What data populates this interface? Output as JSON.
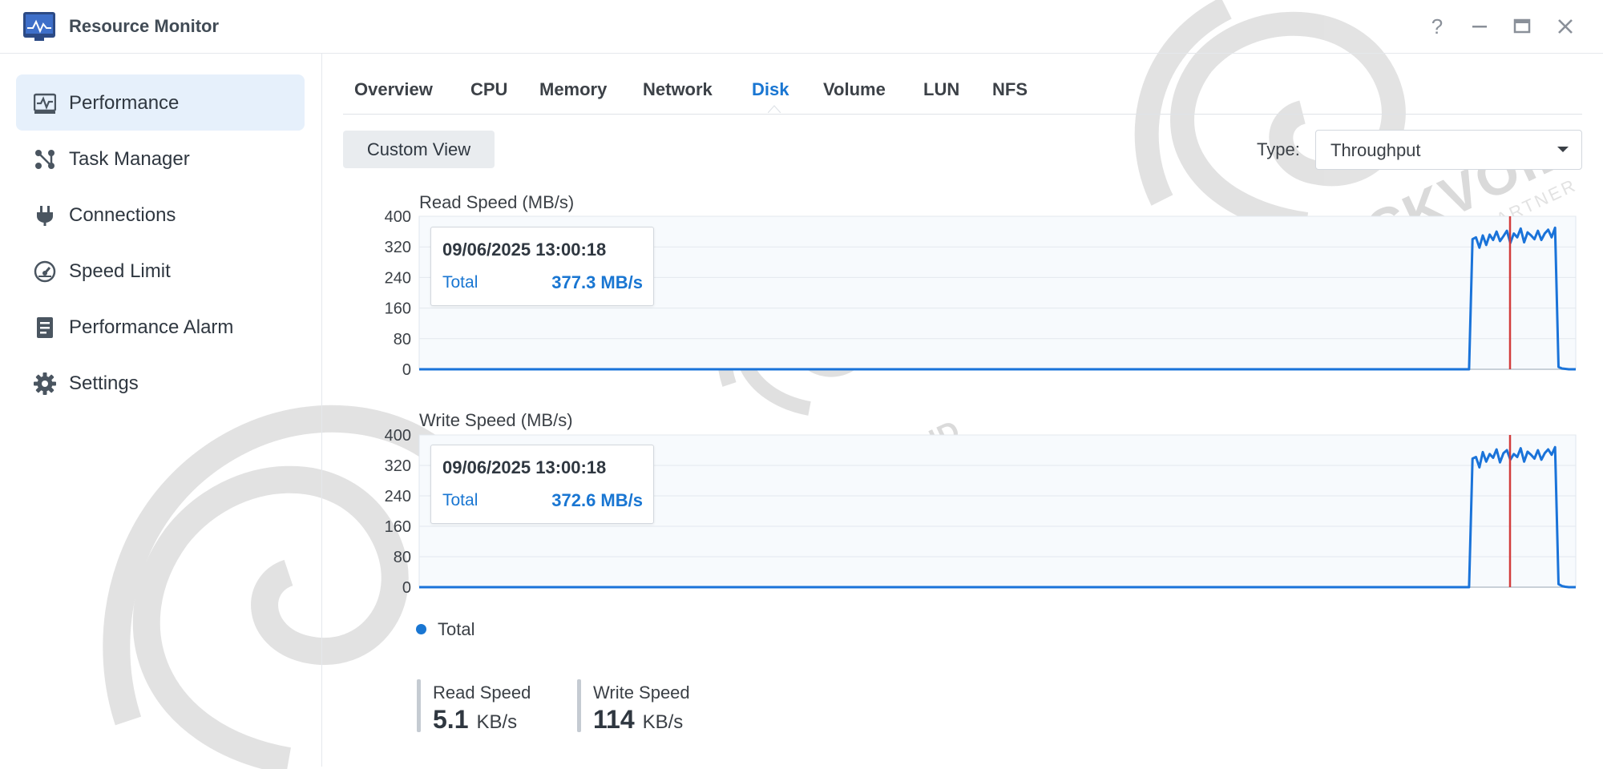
{
  "window": {
    "title": "Resource Monitor",
    "help_icon": "question-icon",
    "minimize_icon": "minimize-icon",
    "maximize_icon": "maximize-icon",
    "close_icon": "close-icon"
  },
  "sidebar": {
    "items": [
      {
        "label": "Performance",
        "icon": "performance-icon",
        "active": true
      },
      {
        "label": "Task Manager",
        "icon": "task-manager-icon",
        "active": false
      },
      {
        "label": "Connections",
        "icon": "plug-icon",
        "active": false
      },
      {
        "label": "Speed Limit",
        "icon": "gauge-icon",
        "active": false
      },
      {
        "label": "Performance Alarm",
        "icon": "document-icon",
        "active": false
      },
      {
        "label": "Settings",
        "icon": "gear-icon",
        "active": false
      }
    ]
  },
  "tabs": [
    {
      "label": "Overview",
      "active": false
    },
    {
      "label": "CPU",
      "active": false
    },
    {
      "label": "Memory",
      "active": false
    },
    {
      "label": "Network",
      "active": false
    },
    {
      "label": "Disk",
      "active": true
    },
    {
      "label": "Volume",
      "active": false
    },
    {
      "label": "LUN",
      "active": false
    },
    {
      "label": "NFS",
      "active": false
    }
  ],
  "toolbar": {
    "custom_view_label": "Custom View",
    "type_label": "Type:",
    "type_value": "Throughput"
  },
  "colors": {
    "accent": "#1976d2",
    "series_line": "#1a73d9",
    "cursor_line": "#d23c3c",
    "active_sidebar_bg": "#e6f0fb"
  },
  "chart_data": [
    {
      "type": "line",
      "title": "Read Speed (MB/s)",
      "ylim": [
        0,
        400
      ],
      "yticks": [
        "400",
        "320",
        "240",
        "160",
        "80",
        "0"
      ],
      "grid": true,
      "series": [
        {
          "name": "Total",
          "color": "#1a73d9",
          "values": [
            0,
            0,
            0,
            0,
            0,
            0,
            0,
            0,
            0,
            0,
            0,
            0,
            0,
            0,
            0,
            0,
            0,
            0,
            0,
            0,
            0,
            0,
            0,
            0,
            0,
            0,
            0,
            0,
            0,
            0,
            0,
            0,
            0,
            0,
            0,
            0,
            0,
            0,
            0,
            0,
            0,
            0,
            0,
            0,
            0,
            0,
            0,
            0,
            0,
            0,
            0,
            0,
            0,
            0,
            0,
            0,
            0,
            0,
            0,
            0,
            0,
            0,
            0,
            0,
            0,
            0,
            0,
            0,
            0,
            0,
            0,
            0,
            0,
            0,
            0,
            0,
            0,
            0,
            0,
            0,
            0,
            0,
            0,
            0,
            0,
            0,
            0,
            0,
            0,
            0,
            0,
            0,
            0,
            0,
            0,
            0,
            0,
            0,
            0,
            0,
            0,
            0,
            0,
            0,
            0,
            0,
            0,
            0,
            0,
            0,
            0,
            0,
            0,
            0,
            0,
            0,
            0,
            0,
            0,
            0,
            0,
            0,
            0,
            0,
            0,
            0,
            0,
            0,
            0,
            0,
            0,
            0,
            0,
            0,
            0,
            0,
            0,
            0,
            0,
            0,
            0,
            0,
            0,
            0,
            0,
            0,
            0,
            0,
            0,
            0,
            0,
            0,
            0,
            0,
            0,
            0,
            0,
            0,
            0,
            0,
            0,
            0,
            0,
            0,
            0,
            0,
            0,
            0,
            0,
            0,
            0,
            0,
            0,
            0,
            0,
            0,
            0,
            0,
            0,
            0,
            0,
            0,
            0,
            0,
            0,
            0,
            0,
            0,
            0,
            0,
            0,
            0,
            0,
            0,
            0,
            0,
            0,
            0,
            0,
            0,
            0,
            0,
            0,
            0,
            0,
            0,
            0,
            0,
            0,
            0,
            0,
            0,
            0,
            0,
            0,
            0,
            0,
            0,
            0,
            0,
            0,
            0,
            0,
            0,
            0,
            0,
            0,
            0,
            0,
            0,
            0,
            0,
            0,
            0,
            0,
            0,
            0,
            0,
            0,
            0,
            0,
            0,
            0,
            0,
            0,
            0,
            0,
            0,
            0,
            0,
            0,
            0,
            0,
            0,
            0,
            0,
            0,
            0,
            0,
            0,
            0,
            0,
            0,
            0,
            0,
            0,
            0,
            0,
            0,
            0,
            0,
            0,
            0,
            0,
            0,
            0,
            0,
            0,
            0,
            0,
            0,
            0,
            0,
            0,
            0,
            0,
            0,
            0,
            0,
            0,
            0,
            0,
            0,
            0,
            0,
            0,
            0,
            0,
            0,
            0,
            0,
            0,
            0,
            0,
            0,
            0,
            340,
            345,
            318,
            350,
            325,
            352,
            338,
            360,
            335,
            348,
            362,
            330,
            355,
            345,
            368,
            332,
            358,
            350,
            340,
            362,
            338,
            355,
            365,
            345,
            370,
            6,
            2,
            1,
            0,
            0,
            0
          ]
        }
      ],
      "tooltip": {
        "time": "09/06/2025 13:00:18",
        "label": "Total",
        "value": "377.3 MB/s"
      }
    },
    {
      "type": "line",
      "title": "Write Speed (MB/s)",
      "ylim": [
        0,
        400
      ],
      "yticks": [
        "400",
        "320",
        "240",
        "160",
        "80",
        "0"
      ],
      "grid": true,
      "series": [
        {
          "name": "Total",
          "color": "#1a73d9",
          "values": [
            0,
            0,
            0,
            0,
            0,
            0,
            0,
            0,
            0,
            0,
            0,
            0,
            0,
            0,
            0,
            0,
            0,
            0,
            0,
            0,
            0,
            0,
            0,
            0,
            0,
            0,
            0,
            0,
            0,
            0,
            0,
            0,
            0,
            0,
            0,
            0,
            0,
            0,
            0,
            0,
            0,
            0,
            0,
            0,
            0,
            0,
            0,
            0,
            0,
            0,
            0,
            0,
            0,
            0,
            0,
            0,
            0,
            0,
            0,
            0,
            0,
            0,
            0,
            0,
            0,
            0,
            0,
            0,
            0,
            0,
            0,
            0,
            0,
            0,
            0,
            0,
            0,
            0,
            0,
            0,
            0,
            0,
            0,
            0,
            0,
            0,
            0,
            0,
            0,
            0,
            0,
            0,
            0,
            0,
            0,
            0,
            0,
            0,
            0,
            0,
            0,
            0,
            0,
            0,
            0,
            0,
            0,
            0,
            0,
            0,
            0,
            0,
            0,
            0,
            0,
            0,
            0,
            0,
            0,
            0,
            0,
            0,
            0,
            0,
            0,
            0,
            0,
            0,
            0,
            0,
            0,
            0,
            0,
            0,
            0,
            0,
            0,
            0,
            0,
            0,
            0,
            0,
            0,
            0,
            0,
            0,
            0,
            0,
            0,
            0,
            0,
            0,
            0,
            0,
            0,
            0,
            0,
            0,
            0,
            0,
            0,
            0,
            0,
            0,
            0,
            0,
            0,
            0,
            0,
            0,
            0,
            0,
            0,
            0,
            0,
            0,
            0,
            0,
            0,
            0,
            0,
            0,
            0,
            0,
            0,
            0,
            0,
            0,
            0,
            0,
            0,
            0,
            0,
            0,
            0,
            0,
            0,
            0,
            0,
            0,
            0,
            0,
            0,
            0,
            0,
            0,
            0,
            0,
            0,
            0,
            0,
            0,
            0,
            0,
            0,
            0,
            0,
            0,
            0,
            0,
            0,
            0,
            0,
            0,
            0,
            0,
            0,
            0,
            0,
            0,
            0,
            0,
            0,
            0,
            0,
            0,
            0,
            0,
            0,
            0,
            0,
            0,
            0,
            0,
            0,
            0,
            0,
            0,
            0,
            0,
            0,
            0,
            0,
            0,
            0,
            0,
            0,
            0,
            0,
            0,
            0,
            0,
            0,
            0,
            0,
            0,
            0,
            0,
            0,
            0,
            0,
            0,
            0,
            0,
            0,
            0,
            0,
            0,
            0,
            0,
            0,
            0,
            0,
            0,
            0,
            0,
            0,
            0,
            0,
            0,
            0,
            0,
            0,
            0,
            0,
            0,
            0,
            0,
            0,
            0,
            0,
            0,
            0,
            0,
            0,
            0,
            338,
            342,
            315,
            355,
            330,
            350,
            340,
            362,
            328,
            352,
            360,
            335,
            350,
            342,
            365,
            330,
            356,
            348,
            338,
            360,
            335,
            352,
            362,
            348,
            368,
            8,
            3,
            1,
            0,
            0,
            0
          ]
        }
      ],
      "tooltip": {
        "time": "09/06/2025 13:00:18",
        "label": "Total",
        "value": "372.6 MB/s"
      }
    }
  ],
  "legend": {
    "label": "Total"
  },
  "stats": [
    {
      "label": "Read Speed",
      "value": "5.1",
      "unit": "KB/s"
    },
    {
      "label": "Write Speed",
      "value": "114",
      "unit": "KB/s"
    }
  ],
  "watermark": {
    "brand": "BLACKVOID",
    "sub": "Synology",
    "tag": "MEDIA PARTNER"
  }
}
